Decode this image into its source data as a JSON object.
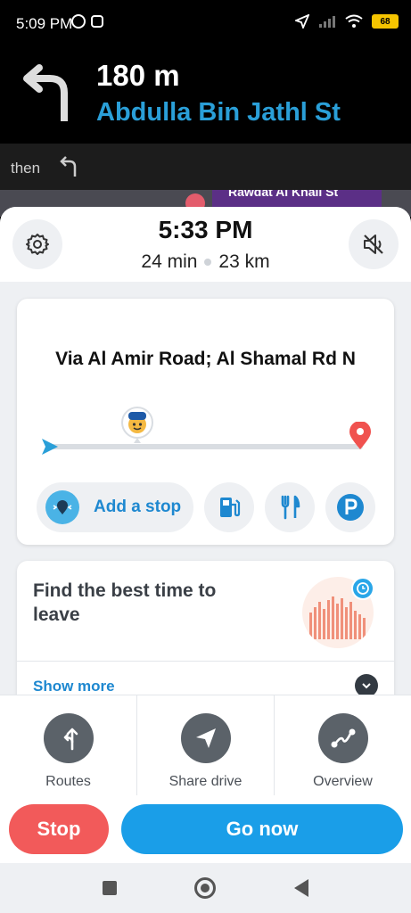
{
  "status_bar": {
    "time": "5:09 PM",
    "battery": "68",
    "icons": [
      "emoji-icon",
      "record-icon",
      "location-arrow-icon",
      "signal-icon",
      "wifi-icon",
      "battery-icon"
    ]
  },
  "nav": {
    "distance": "180 m",
    "street": "Abdulla Bin Jathl St",
    "then_label": "then",
    "turn_icon": "turn-left-icon",
    "street_color": "#2a9fd8"
  },
  "map": {
    "label": "Rawdat Al Khail St"
  },
  "eta": {
    "arrival": "5:33 PM",
    "duration": "24 min",
    "distance": "23 km"
  },
  "route": {
    "via": "Via Al Amir Road; Al Shamal Rd N",
    "add_stop": "Add a stop",
    "quick_icons": [
      "gas-station-icon",
      "restaurant-icon",
      "parking-icon"
    ]
  },
  "leave": {
    "title": "Find the best time to leave",
    "show_more": "Show more"
  },
  "actions": [
    {
      "label": "Routes",
      "icon": "routes-icon"
    },
    {
      "label": "Share drive",
      "icon": "share-drive-icon"
    },
    {
      "label": "Overview",
      "icon": "overview-icon"
    }
  ],
  "buttons": {
    "stop": "Stop",
    "go": "Go now",
    "stop_color": "#f25a5a",
    "go_color": "#1a9ee8"
  }
}
